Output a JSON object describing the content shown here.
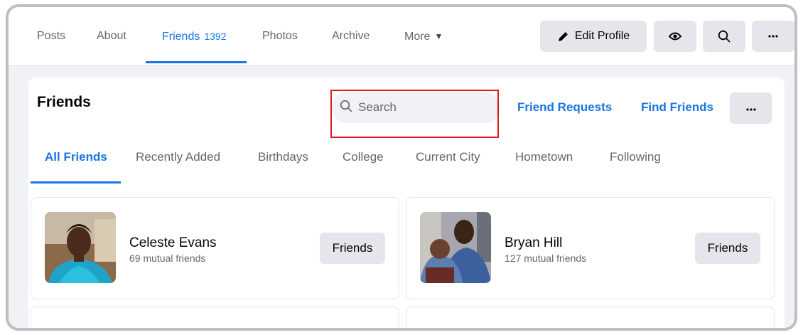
{
  "nav": {
    "tabs": [
      {
        "label": "Posts"
      },
      {
        "label": "About"
      },
      {
        "label": "Friends",
        "count": "1392"
      },
      {
        "label": "Photos"
      },
      {
        "label": "Archive"
      },
      {
        "label": "More"
      }
    ],
    "edit_profile_label": "Edit Profile"
  },
  "friends_card": {
    "title": "Friends",
    "search_placeholder": "Search",
    "friend_requests_label": "Friend Requests",
    "find_friends_label": "Find Friends",
    "subtabs": [
      "All Friends",
      "Recently Added",
      "Birthdays",
      "College",
      "Current City",
      "Hometown",
      "Following"
    ],
    "friends": [
      {
        "name": "Celeste Evans",
        "mutual": "69 mutual friends",
        "button_label": "Friends"
      },
      {
        "name": "Bryan Hill",
        "mutual": "127 mutual friends",
        "button_label": "Friends"
      }
    ]
  },
  "colors": {
    "accent": "#1b74e4",
    "highlight_box": "#e0191f",
    "button_bg": "#e4e6eb",
    "page_bg": "#f0f2f5"
  },
  "icons": [
    "pencil-icon",
    "eye-icon",
    "search-icon",
    "more-icon",
    "caret-down-icon"
  ]
}
